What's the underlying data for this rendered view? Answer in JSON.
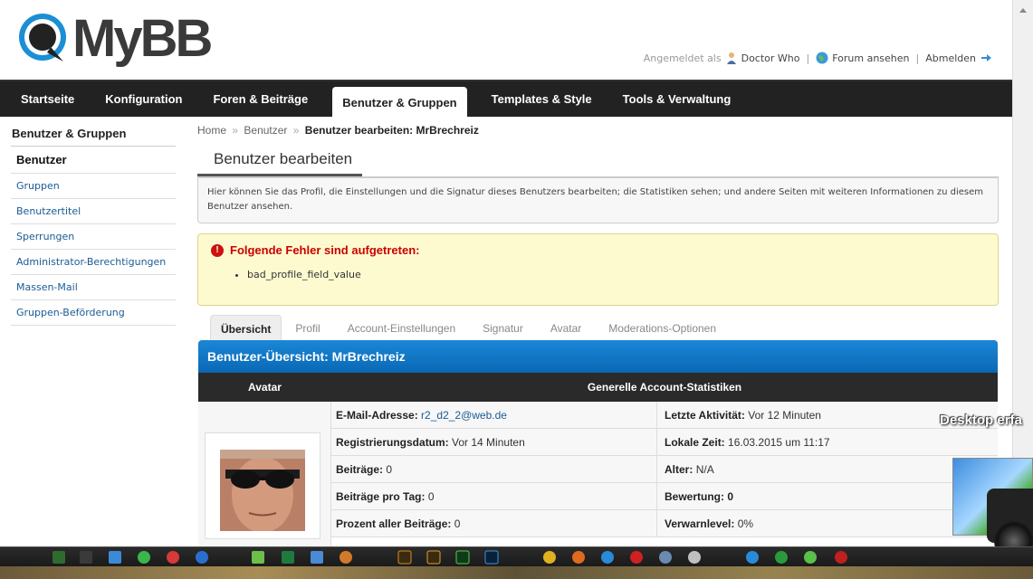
{
  "header": {
    "logo_text": "MyBB",
    "logged_in_as_label": "Angemeldet als",
    "username": "Doctor Who",
    "view_forum": "Forum ansehen",
    "logout": "Abmelden"
  },
  "menu": {
    "tabs": [
      {
        "label": "Startseite"
      },
      {
        "label": "Konfiguration"
      },
      {
        "label": "Foren & Beiträge"
      },
      {
        "label": "Benutzer & Gruppen"
      },
      {
        "label": "Templates & Style"
      },
      {
        "label": "Tools & Verwaltung"
      }
    ],
    "active_index": 3
  },
  "sidebar": {
    "title": "Benutzer & Gruppen",
    "items": [
      {
        "label": "Benutzer"
      },
      {
        "label": "Gruppen"
      },
      {
        "label": "Benutzertitel"
      },
      {
        "label": "Sperrungen"
      },
      {
        "label": "Administrator-Berechtigungen"
      },
      {
        "label": "Massen-Mail"
      },
      {
        "label": "Gruppen-Beförderung"
      }
    ]
  },
  "breadcrumb": {
    "home": "Home",
    "users": "Benutzer",
    "sep": "»",
    "current": "Benutzer bearbeiten: MrBrechreiz"
  },
  "page": {
    "title": "Benutzer bearbeiten",
    "description": "Hier können Sie das Profil, die Einstellungen und die Signatur dieses Benutzers bearbeiten; die Statistiken sehen; und andere Seiten mit weiteren Informationen zu diesem Benutzer ansehen."
  },
  "error": {
    "title": "Folgende Fehler sind aufgetreten:",
    "items": [
      "bad_profile_field_value"
    ]
  },
  "subtabs": [
    "Übersicht",
    "Profil",
    "Account-Einstellungen",
    "Signatur",
    "Avatar",
    "Moderations-Optionen"
  ],
  "panel": {
    "title": "Benutzer-Übersicht: MrBrechreiz",
    "col_avatar": "Avatar",
    "col_stats": "Generelle Account-Statistiken",
    "rows": [
      {
        "l_label": "E-Mail-Adresse:",
        "l_value": "r2_d2_2@web.de",
        "r_label": "Letzte Aktivität:",
        "r_value": "Vor 12 Minuten"
      },
      {
        "l_label": "Registrierungsdatum:",
        "l_value": "Vor 14 Minuten",
        "r_label": "Lokale Zeit:",
        "r_value": "16.03.2015 um 11:17"
      },
      {
        "l_label": "Beiträge:",
        "l_value": "0",
        "r_label": "Alter:",
        "r_value": "N/A"
      },
      {
        "l_label": "Beiträge pro Tag:",
        "l_value": "0",
        "r_label": "Bewertung:",
        "r_value": "0"
      },
      {
        "l_label": "Prozent aller Beiträge:",
        "l_value": "0",
        "r_label": "Verwarnlevel:",
        "r_value": "0%"
      }
    ]
  },
  "desktop": {
    "label": "Desktop erfa"
  },
  "colors": {
    "menu_bg": "#222222",
    "panel_head": "#0d72c0",
    "error_bg": "#fdfad0",
    "link": "#1a5b94"
  }
}
